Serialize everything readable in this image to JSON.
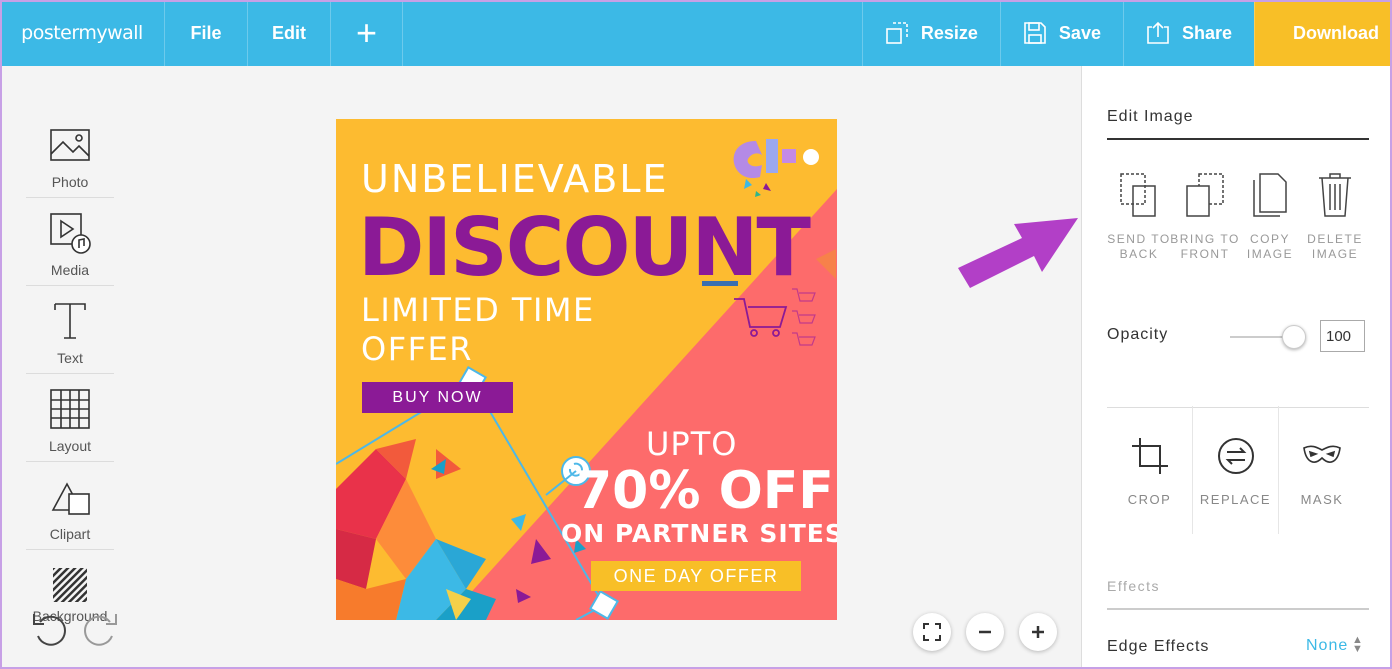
{
  "app": {
    "logo": "postermywall"
  },
  "toolbar": {
    "file_label": "File",
    "edit_label": "Edit",
    "add_symbol": "+",
    "resize_label": "Resize",
    "save_label": "Save",
    "share_label": "Share",
    "download_label": "Download"
  },
  "sidebar": {
    "items": [
      {
        "label": "Photo",
        "icon": "photo-icon"
      },
      {
        "label": "Media",
        "icon": "media-icon"
      },
      {
        "label": "Text",
        "icon": "text-icon"
      },
      {
        "label": "Layout",
        "icon": "layout-icon"
      },
      {
        "label": "Clipart",
        "icon": "clipart-icon"
      },
      {
        "label": "Background",
        "icon": "background-icon"
      }
    ]
  },
  "poster": {
    "headline_top": "UNBELIEVABLE",
    "headline_main": "DISCOUNT",
    "limited_line1": "LIMITED TIME",
    "limited_line2": "OFFER",
    "buy_now": "BUY NOW",
    "upto": "UPTO",
    "percent_off": "70% OFF",
    "partner_sites": "ON PARTNER SITES",
    "one_day": "ONE DAY OFFER",
    "colors": {
      "yellow": "#fdbb30",
      "coral": "#fd6b6b",
      "purple": "#8b1a96"
    }
  },
  "panel": {
    "title": "Edit Image",
    "actions": [
      {
        "label": "SEND TO BACK",
        "icon": "send-to-back-icon"
      },
      {
        "label": "BRING TO FRONT",
        "icon": "bring-to-front-icon"
      },
      {
        "label": "COPY IMAGE",
        "icon": "copy-image-icon"
      },
      {
        "label": "DELETE IMAGE",
        "icon": "trash-icon"
      }
    ],
    "opacity_label": "Opacity",
    "opacity_value": "100",
    "tools": [
      {
        "label": "CROP",
        "icon": "crop-icon"
      },
      {
        "label": "REPLACE",
        "icon": "replace-icon"
      },
      {
        "label": "MASK",
        "icon": "mask-icon"
      }
    ],
    "effects_label": "Effects",
    "edge_effects_label": "Edge Effects",
    "edge_effects_value": "None"
  },
  "colors": {
    "topbar": "#3cb9e6",
    "download": "#f8bf27",
    "annotation_arrow": "#b23fc7"
  }
}
